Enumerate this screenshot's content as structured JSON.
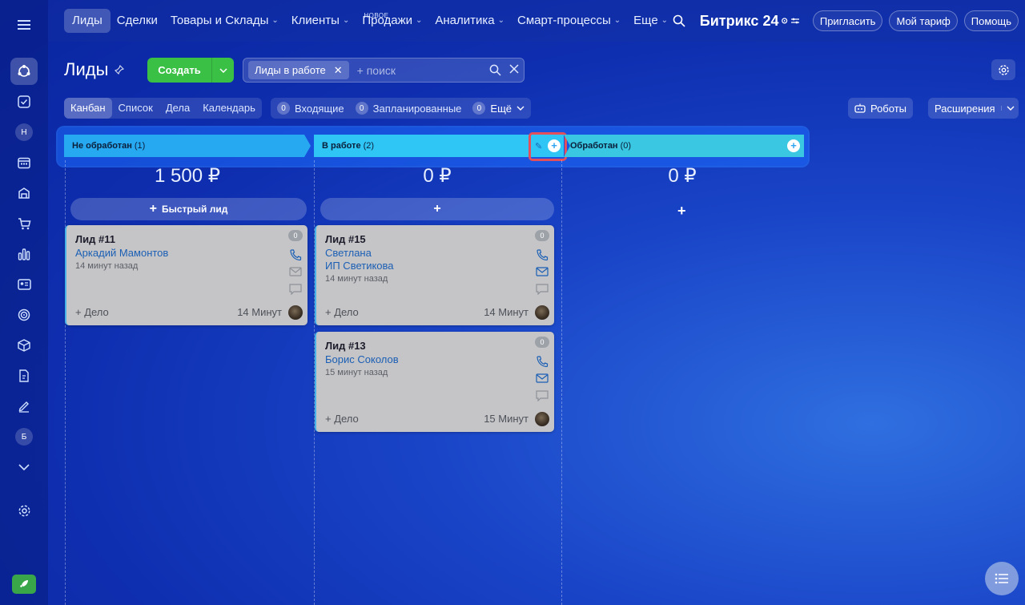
{
  "rail": {
    "letters": [
      "Н",
      "Б"
    ]
  },
  "nav": {
    "items": [
      {
        "label": "Лиды"
      },
      {
        "label": "Сделки"
      },
      {
        "label": "Товары и Склады"
      },
      {
        "label": "Клиенты"
      },
      {
        "label": "Продажи",
        "badge": "НОВОЕ"
      },
      {
        "label": "Аналитика"
      },
      {
        "label": "Смарт-процессы"
      },
      {
        "label": "Еще"
      }
    ],
    "brand": "Битрикс 24",
    "invite": "Пригласить",
    "tariff": "Мой тариф",
    "help": "Помощь"
  },
  "header": {
    "title": "Лиды",
    "create": "Создать",
    "filter_chip": "Лиды в работе",
    "search_placeholder": "+ поиск"
  },
  "toolbar": {
    "views": [
      "Канбан",
      "Список",
      "Дела",
      "Календарь"
    ],
    "counters": [
      {
        "num": "0",
        "label": "Входящие"
      },
      {
        "num": "0",
        "label": "Запланированные"
      },
      {
        "num": "0",
        "label": "Ещё"
      }
    ],
    "robots": "Роботы",
    "extensions": "Расширения"
  },
  "kanban": {
    "stages": [
      {
        "name": "Не обработан",
        "count": "(1)",
        "sum": "1 500 ₽",
        "quick": "Быстрый лид",
        "color": "#27a9f1"
      },
      {
        "name": "В работе",
        "count": "(2)",
        "sum": "0 ₽",
        "color": "#2fc6f6"
      },
      {
        "name": "Обработан",
        "count": "(0)",
        "sum": "0 ₽",
        "color": "#39c7e2"
      }
    ],
    "cards": [
      {
        "title": "Лид #11",
        "client": "Аркадий Мамонтов",
        "time": "14 минут назад",
        "badge": "0",
        "deal": "+ Дело",
        "ago": "14 Минут"
      },
      {
        "title": "Лид #15",
        "client": "Светлана",
        "company": "ИП Светикова",
        "time": "14 минут назад",
        "badge": "0",
        "deal": "+ Дело",
        "ago": "14 Минут"
      },
      {
        "title": "Лид #13",
        "client": "Борис Соколов",
        "time": "15 минут назад",
        "badge": "0",
        "deal": "+ Дело",
        "ago": "15 Минут"
      }
    ]
  }
}
